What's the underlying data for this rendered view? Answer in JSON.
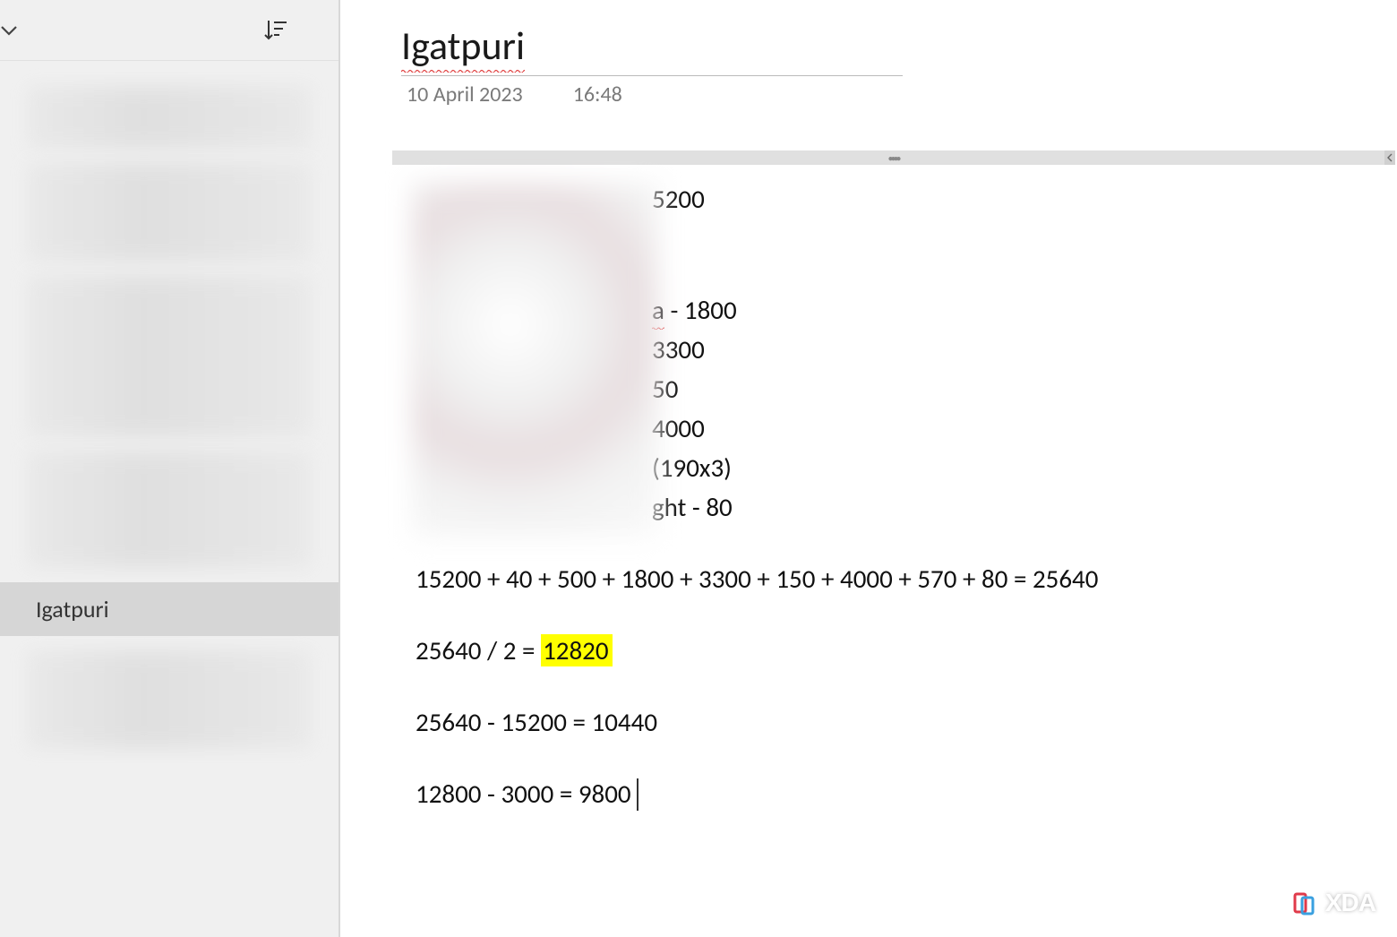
{
  "sidebar": {
    "selected_page": "Igatpuri"
  },
  "note": {
    "title": "Igatpuri",
    "date": "10 April 2023",
    "time": "16:48"
  },
  "content": {
    "partial_lines": {
      "l1": "5200",
      "l2_suffix": " - 1800",
      "l2_prefix": "a",
      "l3": "3300",
      "l4": "50",
      "l5": "4000",
      "l6": " (190x3)",
      "l7": "ght - 80"
    },
    "calc1": "15200 + 40 + 500 + 1800 + 3300 + 150 + 4000 + 570 + 80 = 25640",
    "calc2_prefix": "25640 / 2 = ",
    "calc2_highlight": "12820",
    "calc3": "25640 - 15200 = 10440",
    "calc4": "12800 - 3000 = 9800"
  },
  "watermark": {
    "text": "XDA"
  }
}
